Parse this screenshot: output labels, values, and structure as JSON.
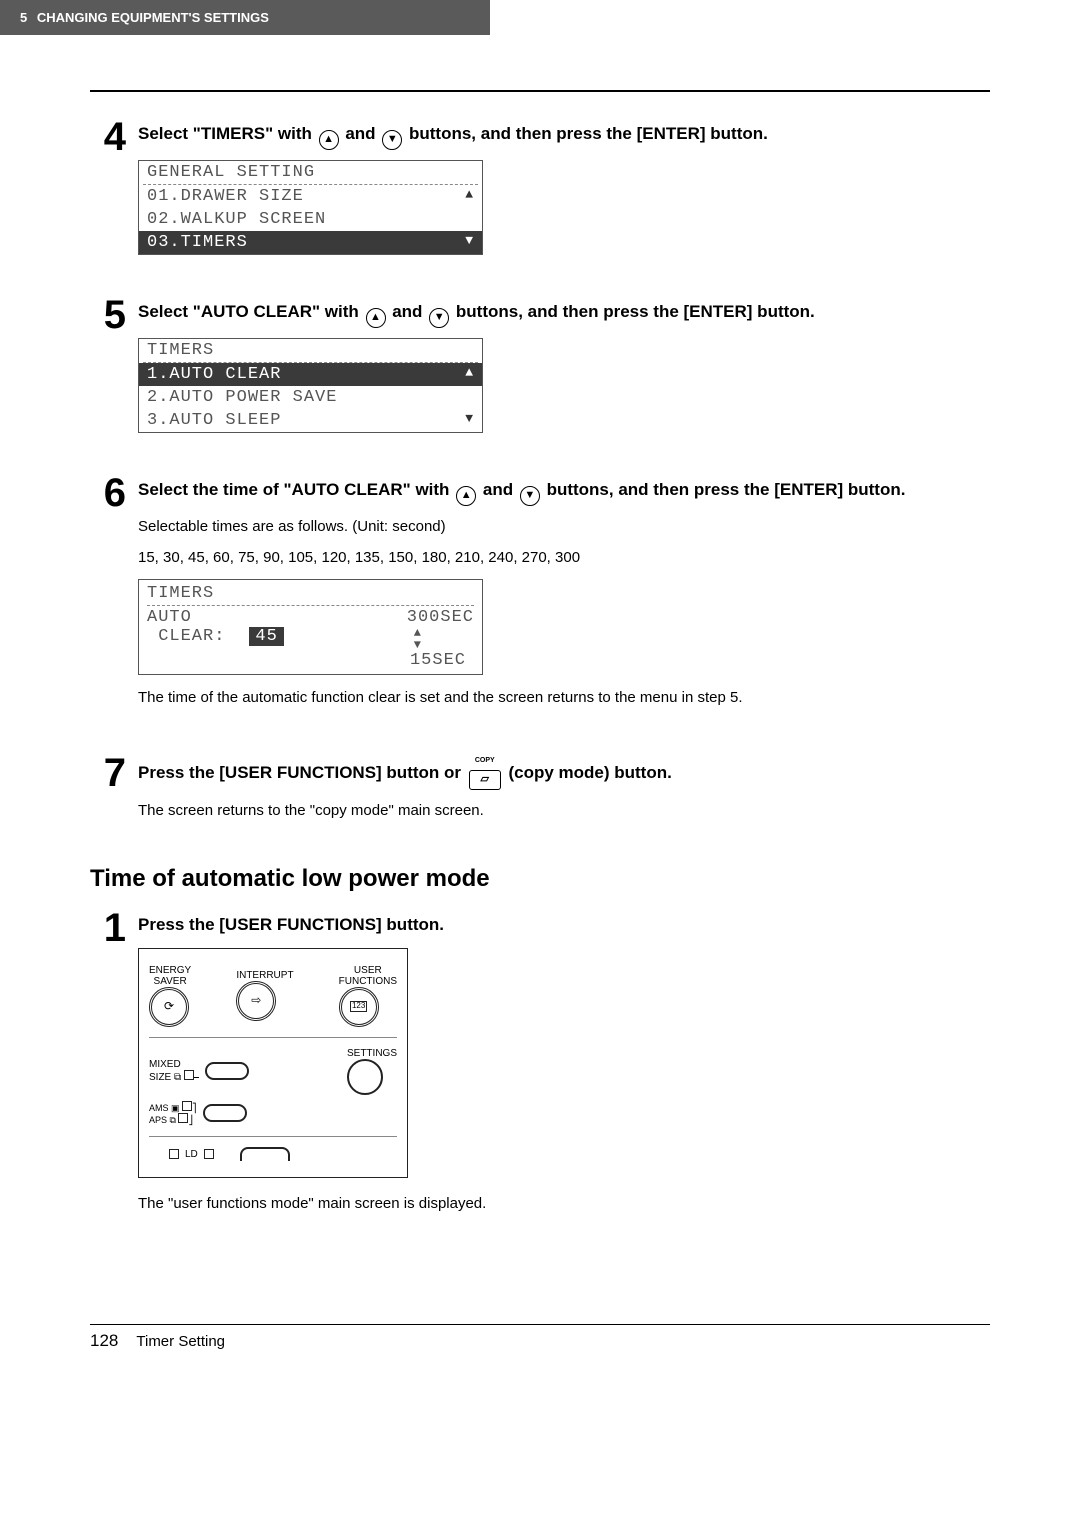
{
  "header": {
    "chapter_num": "5",
    "chapter_title": "CHANGING EQUIPMENT'S SETTINGS"
  },
  "steps_a": [
    {
      "num": "4",
      "title_pre": "Select \"TIMERS\" with ",
      "title_mid": " and ",
      "title_post": " buttons, and then press the [ENTER] button.",
      "lcd": {
        "title": "GENERAL SETTING",
        "rows": [
          {
            "text": "01.DRAWER SIZE",
            "arrow": "▲",
            "sel": false
          },
          {
            "text": "02.WALKUP SCREEN",
            "arrow": "",
            "sel": false
          },
          {
            "text": "03.TIMERS",
            "arrow": "▼",
            "sel": true
          }
        ]
      }
    },
    {
      "num": "5",
      "title_pre": "Select \"AUTO CLEAR\" with ",
      "title_mid": " and ",
      "title_post": " buttons, and then press the [ENTER] button.",
      "lcd": {
        "title": "TIMERS",
        "rows": [
          {
            "text": "1.AUTO CLEAR",
            "arrow": "▲",
            "sel": true
          },
          {
            "text": "2.AUTO POWER SAVE",
            "arrow": "",
            "sel": false
          },
          {
            "text": "3.AUTO SLEEP",
            "arrow": "▼",
            "sel": false
          }
        ]
      }
    }
  ],
  "step6": {
    "num": "6",
    "title_pre": "Select the time of \"AUTO CLEAR\" with ",
    "title_mid": " and ",
    "title_post": " buttons, and then press the [ENTER] button.",
    "desc1": "Selectable times are as follows. (Unit: second)",
    "desc2": "15, 30, 45, 60, 75, 90, 105, 120, 135, 150, 180, 210, 240, 270, 300",
    "lcd": {
      "title": "TIMERS",
      "label_auto": "AUTO",
      "label_clear": "CLEAR:",
      "value": "45",
      "upper_hint": "300SEC",
      "lower_hint": "15SEC"
    },
    "note": "The time of the automatic function clear is set and the screen returns to the menu in step 5."
  },
  "step7": {
    "num": "7",
    "title_pre": "Press the [USER FUNCTIONS] button or ",
    "title_post": " (copy mode) button.",
    "copy_label": "COPY",
    "desc": "The screen returns to the \"copy mode\" main screen."
  },
  "section_title": "Time of automatic low power mode",
  "step_b1": {
    "num": "1",
    "title": "Press the [USER FUNCTIONS] button.",
    "panel": {
      "energy_saver": "ENERGY\nSAVER",
      "interrupt": "INTERRUPT",
      "user_functions": "USER\nFUNCTIONS",
      "mixed_size": "MIXED\nSIZE",
      "settings": "SETTINGS",
      "ams": "AMS",
      "aps": "APS",
      "ld": "LD",
      "ufn_icon": "123"
    },
    "desc": "The \"user functions mode\" main screen is displayed."
  },
  "footer": {
    "page_num": "128",
    "section": "Timer Setting"
  }
}
